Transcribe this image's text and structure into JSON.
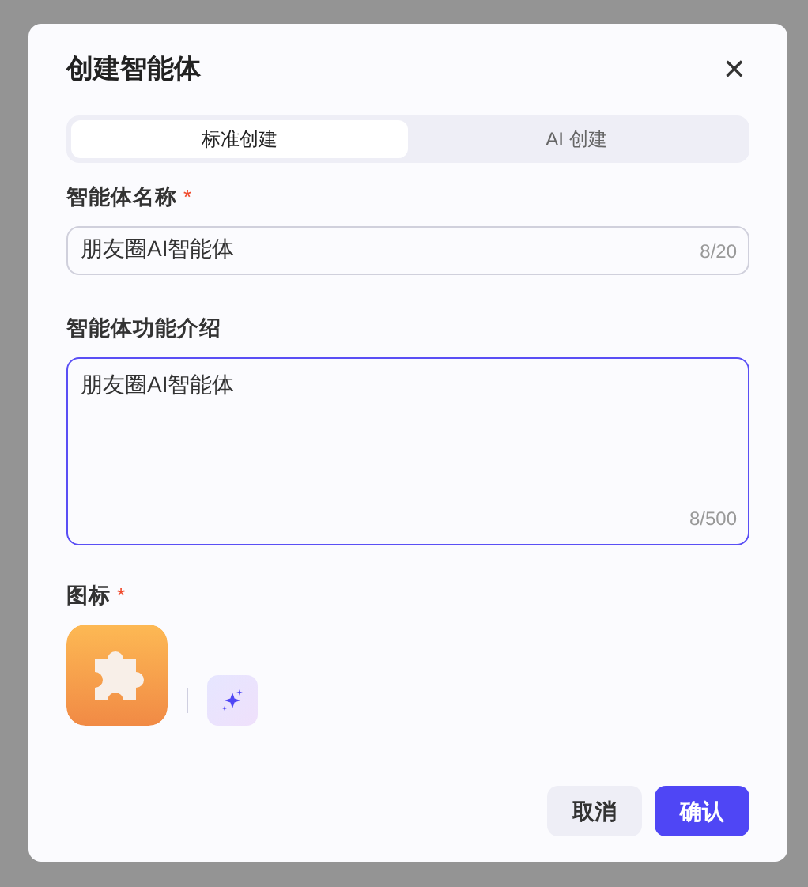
{
  "dialog": {
    "title": "创建智能体",
    "close": "✕"
  },
  "tabs": [
    {
      "label": "标准创建",
      "selected": true
    },
    {
      "label": "AI 创建",
      "selected": false
    }
  ],
  "fields": [
    {
      "kind": "input",
      "label": "智能体名称",
      "required_mark": "*",
      "value": "朋友圈AI智能体",
      "counter": "8/20",
      "focused": false
    },
    {
      "kind": "textarea",
      "label": "智能体功能介绍",
      "value": "朋友圈AI智能体",
      "counter": "8/500",
      "focused": true
    },
    {
      "kind": "icon",
      "label": "图标",
      "required_mark": "*"
    }
  ],
  "buttons": [
    {
      "label": "取消",
      "kind": "secondary"
    },
    {
      "label": "确认",
      "kind": "primary"
    }
  ]
}
